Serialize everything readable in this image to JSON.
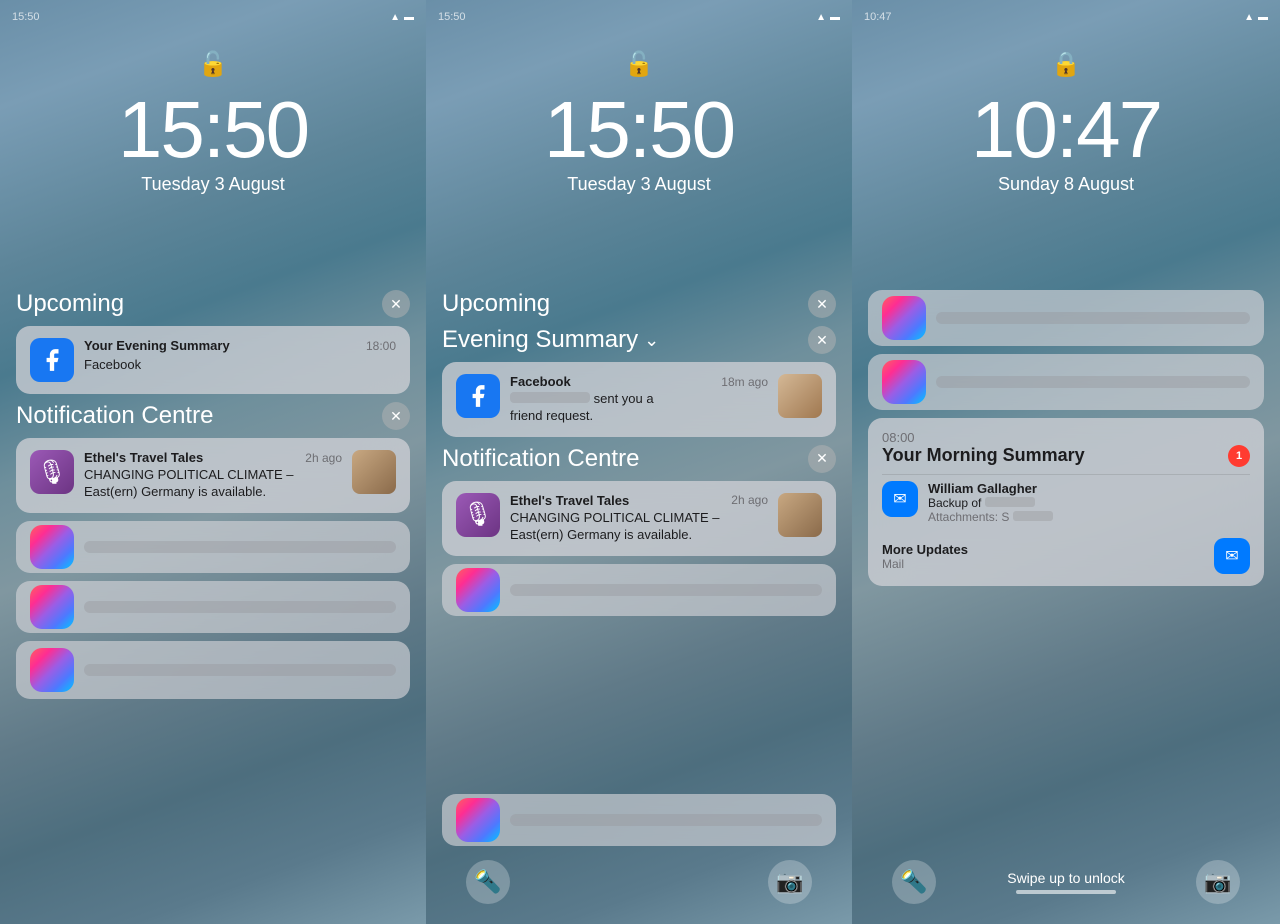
{
  "panels": [
    {
      "id": "panel-left",
      "statusTime": "15:50",
      "lockState": "unlocked",
      "time": "15:50",
      "date": "Tuesday 3 August",
      "sections": [
        {
          "id": "upcoming-left",
          "title": "Upcoming",
          "hasClose": true,
          "notifications": [
            {
              "id": "fb-evening-summary",
              "appName": "Facebook",
              "appIcon": "facebook",
              "title": "Your Evening Summary",
              "time": "18:00",
              "body": "Facebook",
              "hasThumbnail": false
            }
          ]
        },
        {
          "id": "notif-centre-left",
          "title": "Notification Centre",
          "hasClose": true,
          "notifications": [
            {
              "id": "podcast-left",
              "appName": "Ethel's Travel Tales",
              "appIcon": "podcasts",
              "title": "CHANGING POLITICAL CLIMATE –",
              "time": "2h ago",
              "body": "East(ern) Germany is available.",
              "hasThumbnail": true
            }
          ],
          "blurredCards": [
            2
          ]
        }
      ],
      "bottomBar": false
    },
    {
      "id": "panel-middle",
      "statusTime": "15:50",
      "lockState": "unlocked",
      "time": "15:50",
      "date": "Tuesday 3 August",
      "sections": [
        {
          "id": "upcoming-middle",
          "title": "Upcoming",
          "hasClose": true,
          "subsection": {
            "title": "Evening Summary",
            "hasChevron": true,
            "hasClose": true,
            "notifications": [
              {
                "id": "fb-friend-request",
                "appName": "Facebook",
                "appIcon": "facebook",
                "title": "",
                "time": "18m ago",
                "body": "sent you a friend request.",
                "hasThumbnail": true
              }
            ]
          }
        },
        {
          "id": "notif-centre-middle",
          "title": "Notification Centre",
          "hasClose": true,
          "notifications": [
            {
              "id": "podcast-middle",
              "appName": "Ethel's Travel Tales",
              "appIcon": "podcasts",
              "title": "CHANGING POLITICAL CLIMATE –",
              "time": "2h ago",
              "body": "East(ern) Germany is available.",
              "hasThumbnail": true
            }
          ],
          "blurredCards": [
            1
          ]
        }
      ],
      "bottomBar": true,
      "bottomBarIcons": [
        "flashlight",
        "camera"
      ]
    },
    {
      "id": "panel-right",
      "statusTime": "10:47",
      "lockState": "locked",
      "time": "10:47",
      "date": "Sunday 8 August",
      "sections": [],
      "blurredTopCards": [
        2
      ],
      "morningSummary": {
        "time": "08:00",
        "title": "Your Morning Summary",
        "badge": "1",
        "items": [
          {
            "appName": "Mail",
            "appIcon": "mail",
            "title": "William Gallagher",
            "body": "Backup of",
            "body2": "Attachments: S"
          }
        ],
        "moreUpdates": {
          "label": "More Updates",
          "sub": "Mail",
          "icon": "mail"
        }
      },
      "bottomBar": true,
      "swipeText": "Swipe up to unlock",
      "bottomBarIcons": [
        "flashlight",
        "camera"
      ]
    }
  ],
  "icons": {
    "wifi": "📶",
    "battery_full": "🔋",
    "lock_closed": "🔒",
    "lock_open": "🔓",
    "close_x": "✕",
    "chevron_down": "⌄",
    "flashlight": "🔦",
    "camera": "📷"
  },
  "colors": {
    "accent_blue": "#007AFF",
    "accent_red": "#FF3B30",
    "card_bg": "rgba(210,210,215,0.75)",
    "text_primary": "#1c1c1e",
    "text_secondary": "#6e6e73"
  }
}
